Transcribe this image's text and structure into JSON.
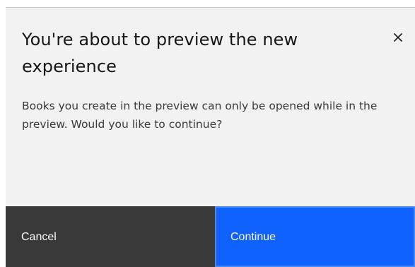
{
  "modal": {
    "title": "You're about to preview the new experience",
    "body": "Books you create in the preview can only be opened while in the preview. Would you like to continue?",
    "close_icon": "close-icon",
    "buttons": {
      "cancel_label": "Cancel",
      "continue_label": "Continue"
    },
    "colors": {
      "background": "#f2f2f2",
      "cancel_bg": "#393939",
      "continue_bg": "#0f62fe",
      "text": "#161616"
    }
  }
}
